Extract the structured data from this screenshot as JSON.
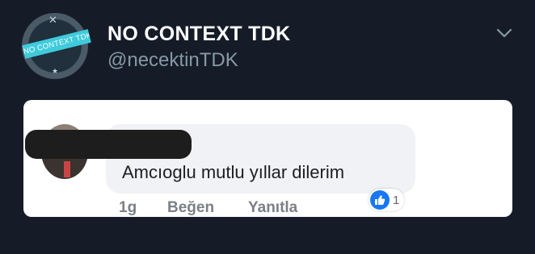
{
  "tweet": {
    "display_name": "NO CONTEXT TDK",
    "username": "@necektinTDK",
    "avatar_banner": "NO CONTEXT TDK",
    "avatar_top_icon": "✕",
    "avatar_bottom_icon": "★",
    "menu_icon": "chevron-down-icon"
  },
  "comment": {
    "author_redacted": true,
    "text": "Amcıoglu mutlu yıllar dilerim",
    "time": "1g",
    "like_label": "Beğen",
    "reply_label": "Yanıtla",
    "reaction_icon": "thumbs-up-icon",
    "reaction_count": "1"
  },
  "colors": {
    "background": "#151c28",
    "avatar_banner": "#3ecbdc",
    "like_blue": "#1877f2",
    "redaction": "#1d1d1d"
  }
}
